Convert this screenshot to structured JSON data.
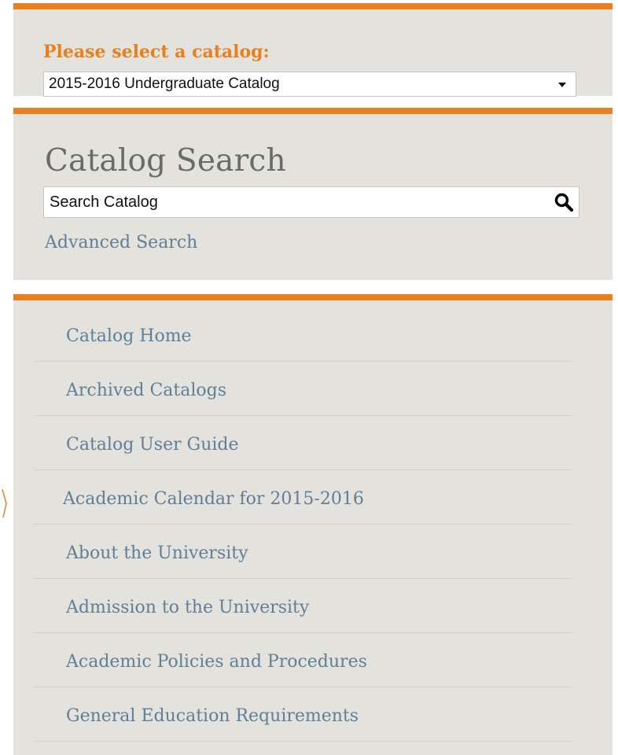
{
  "catalog_selector": {
    "label": "Please select a catalog:",
    "selected": "2015-2016 Undergraduate Catalog",
    "selected_year": "2015-2016",
    "selected_name": "Undergraduate Catalog"
  },
  "search": {
    "title": "Catalog Search",
    "placeholder": "Search Catalog",
    "advanced_label": "Advanced Search"
  },
  "nav": {
    "items": [
      {
        "label": "Catalog Home"
      },
      {
        "label": "Archived Catalogs"
      },
      {
        "label": "Catalog User Guide"
      },
      {
        "label": "Academic Calendar for 2015-2016"
      },
      {
        "label": "About the University"
      },
      {
        "label": "Admission to the University"
      },
      {
        "label": "Academic Policies and Procedures"
      },
      {
        "label": "General Education Requirements"
      }
    ]
  },
  "colors": {
    "accent_orange": "#e8801f",
    "panel_bg": "#e4e2dd",
    "link_blue": "#5f7f96",
    "title_gray": "#6a6a6a"
  },
  "icons": {
    "search": "search-icon",
    "dropdown": "chevron-down-icon"
  }
}
